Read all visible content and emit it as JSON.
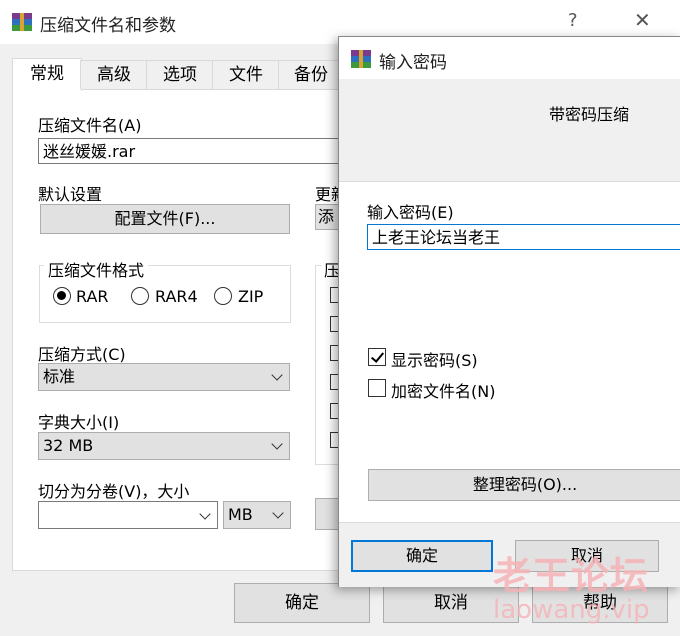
{
  "main_window": {
    "title": "压缩文件名和参数",
    "help_glyph": "?",
    "close_glyph": "✕",
    "tabs": [
      "常规",
      "高级",
      "选项",
      "文件",
      "备份"
    ],
    "archive_name_label": "压缩文件名(A)",
    "archive_name_value": "迷丝媛媛.rar",
    "default_settings_label": "默认设置",
    "profiles_button": "配置文件(F)...",
    "update_label_partial": "更新",
    "update_combo_partial": "添",
    "format_group_title": "压缩文件格式",
    "formats": [
      "RAR",
      "RAR4",
      "ZIP"
    ],
    "selected_format": "RAR",
    "options_group_partial": "压",
    "method_label": "压缩方式(C)",
    "method_value": "标准",
    "dict_label": "字典大小(I)",
    "dict_value": "32 MB",
    "split_label": "切分为分卷(V)，大小",
    "split_value": "",
    "split_unit": "MB",
    "ok_button": "确定",
    "cancel_button": "取消",
    "help_button": "帮助"
  },
  "password_dialog": {
    "title": "输入密码",
    "subtitle": "带密码压缩",
    "password_label": "输入密码(E)",
    "password_value": "上老王论坛当老王",
    "show_password_label": "显示密码(S)",
    "show_password_checked": true,
    "encrypt_names_label": "加密文件名(N)",
    "encrypt_names_checked": false,
    "organize_button": "整理密码(O)...",
    "ok_button": "确定",
    "cancel_button": "取消"
  },
  "watermark": {
    "text": "老王论坛",
    "url": "laowang.vip",
    "color": "#f6b3b7"
  },
  "colors": {
    "focus_blue": "#0078d7",
    "window_bg": "#f0f0f0"
  }
}
